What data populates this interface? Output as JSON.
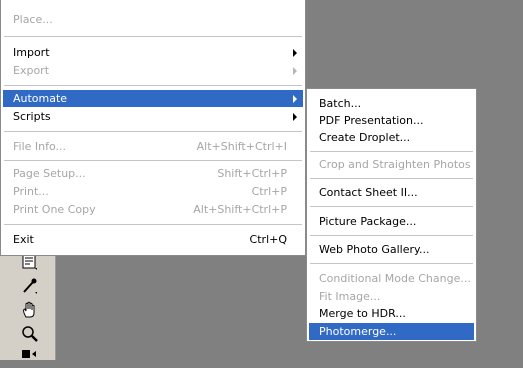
{
  "file_menu": {
    "items": [
      {
        "label": "Place...",
        "disabled": true
      },
      {
        "label": "Import",
        "submenu": true
      },
      {
        "label": "Export",
        "disabled": true,
        "submenu": true
      },
      {
        "label": "Automate",
        "selected": true,
        "submenu": true
      },
      {
        "label": "Scripts",
        "submenu": true
      },
      {
        "label": "File Info...",
        "shortcut": "Alt+Shift+Ctrl+I",
        "disabled": true
      },
      {
        "label": "Page Setup...",
        "shortcut": "Shift+Ctrl+P",
        "disabled": true
      },
      {
        "label": "Print...",
        "shortcut": "Ctrl+P",
        "disabled": true
      },
      {
        "label": "Print One Copy",
        "shortcut": "Alt+Shift+Ctrl+P",
        "disabled": true
      },
      {
        "label": "Exit",
        "shortcut": "Ctrl+Q"
      }
    ]
  },
  "automate_submenu": {
    "items": [
      {
        "label": "Batch..."
      },
      {
        "label": "PDF Presentation..."
      },
      {
        "label": "Create Droplet..."
      },
      {
        "label": "Crop and Straighten Photos",
        "disabled": true
      },
      {
        "label": "Contact Sheet II..."
      },
      {
        "label": "Picture Package..."
      },
      {
        "label": "Web Photo Gallery..."
      },
      {
        "label": "Conditional Mode Change...",
        "disabled": true
      },
      {
        "label": "Fit Image...",
        "disabled": true
      },
      {
        "label": "Merge to HDR..."
      },
      {
        "label": "Photomerge...",
        "selected": true
      }
    ]
  },
  "toolbox": {
    "tools": [
      "notes-tool-icon",
      "eyedropper-tool-icon",
      "hand-tool-icon",
      "zoom-tool-icon"
    ]
  },
  "colors": {
    "selection": "#316ac5",
    "disabled_text": "#a6a6a6",
    "desktop": "#808080",
    "menu_bg": "#ffffff"
  }
}
